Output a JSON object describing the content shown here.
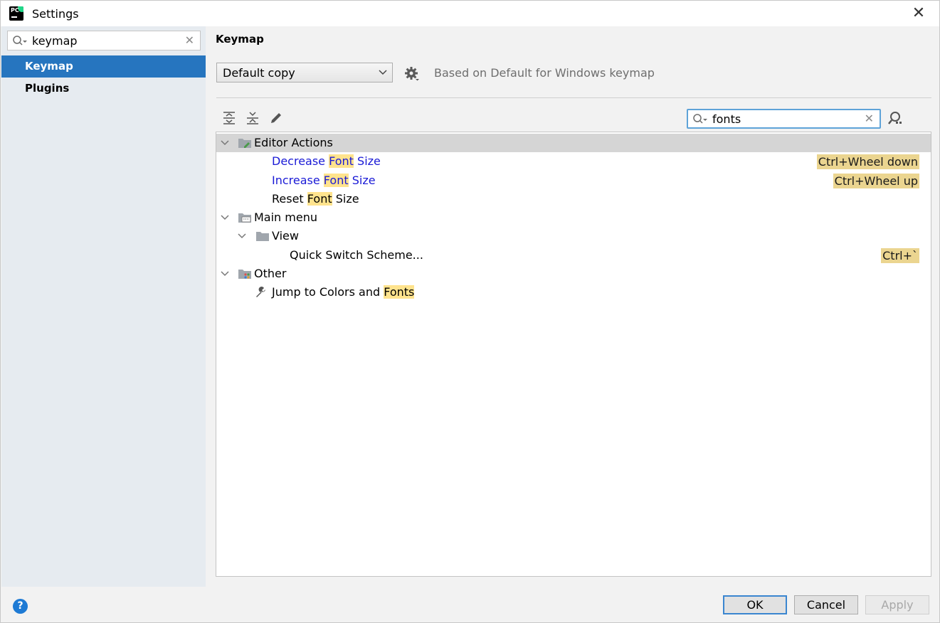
{
  "window": {
    "title": "Settings"
  },
  "sidebar": {
    "search_value": "keymap",
    "items": [
      {
        "label": "Keymap",
        "selected": true
      },
      {
        "label": "Plugins",
        "selected": false
      }
    ]
  },
  "content": {
    "title": "Keymap",
    "keymap_select": "Default copy",
    "based_on": "Based on Default for Windows keymap",
    "search_value": "fonts",
    "toolbar_icons": [
      "expand-all-icon",
      "collapse-all-icon",
      "edit-icon"
    ]
  },
  "tree": {
    "editor_actions": {
      "label": "Editor Actions",
      "decrease": {
        "pre": "Decrease ",
        "hl": "Font",
        "post": " Size",
        "shortcut": "Ctrl+Wheel down"
      },
      "increase": {
        "pre": "Increase ",
        "hl": "Font",
        "post": " Size",
        "shortcut": "Ctrl+Wheel up"
      },
      "reset": {
        "pre": "Reset ",
        "hl": "Font",
        "post": " Size"
      }
    },
    "main_menu": {
      "label": "Main menu",
      "view": {
        "label": "View",
        "quick_switch": {
          "label": "Quick Switch Scheme...",
          "shortcut": "Ctrl+`"
        }
      }
    },
    "other": {
      "label": "Other",
      "jump": {
        "pre": "Jump to Colors and ",
        "hl": "Fonts"
      }
    }
  },
  "buttons": {
    "ok": "OK",
    "cancel": "Cancel",
    "apply": "Apply",
    "help": "?"
  },
  "colors": {
    "selection": "#2675bf",
    "highlight": "#ffe38d",
    "shortcut_bg": "#ebd590",
    "modified_text": "#1a1ad6"
  }
}
